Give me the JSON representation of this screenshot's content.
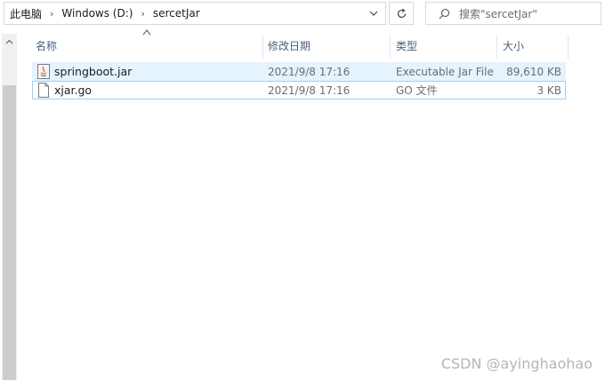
{
  "breadcrumb": {
    "items": [
      "此电脑",
      "Windows (D:)",
      "sercetJar"
    ]
  },
  "search": {
    "placeholder": "搜索\"sercetJar\""
  },
  "columns": {
    "name": "名称",
    "date": "修改日期",
    "type": "类型",
    "size": "大小"
  },
  "files": [
    {
      "name": "springboot.jar",
      "date": "2021/9/8 17:16",
      "type": "Executable Jar File",
      "size": "89,610 KB",
      "icon": "jar-file-icon"
    },
    {
      "name": "xjar.go",
      "date": "2021/9/8 17:16",
      "type": "GO 文件",
      "size": "3 KB",
      "icon": "document-file-icon"
    }
  ],
  "watermark": "CSDN @ayinghaohao",
  "colors": {
    "hover": "#e5f3ff",
    "focus_border": "#99d1ff",
    "header_text": "#4c607a"
  }
}
